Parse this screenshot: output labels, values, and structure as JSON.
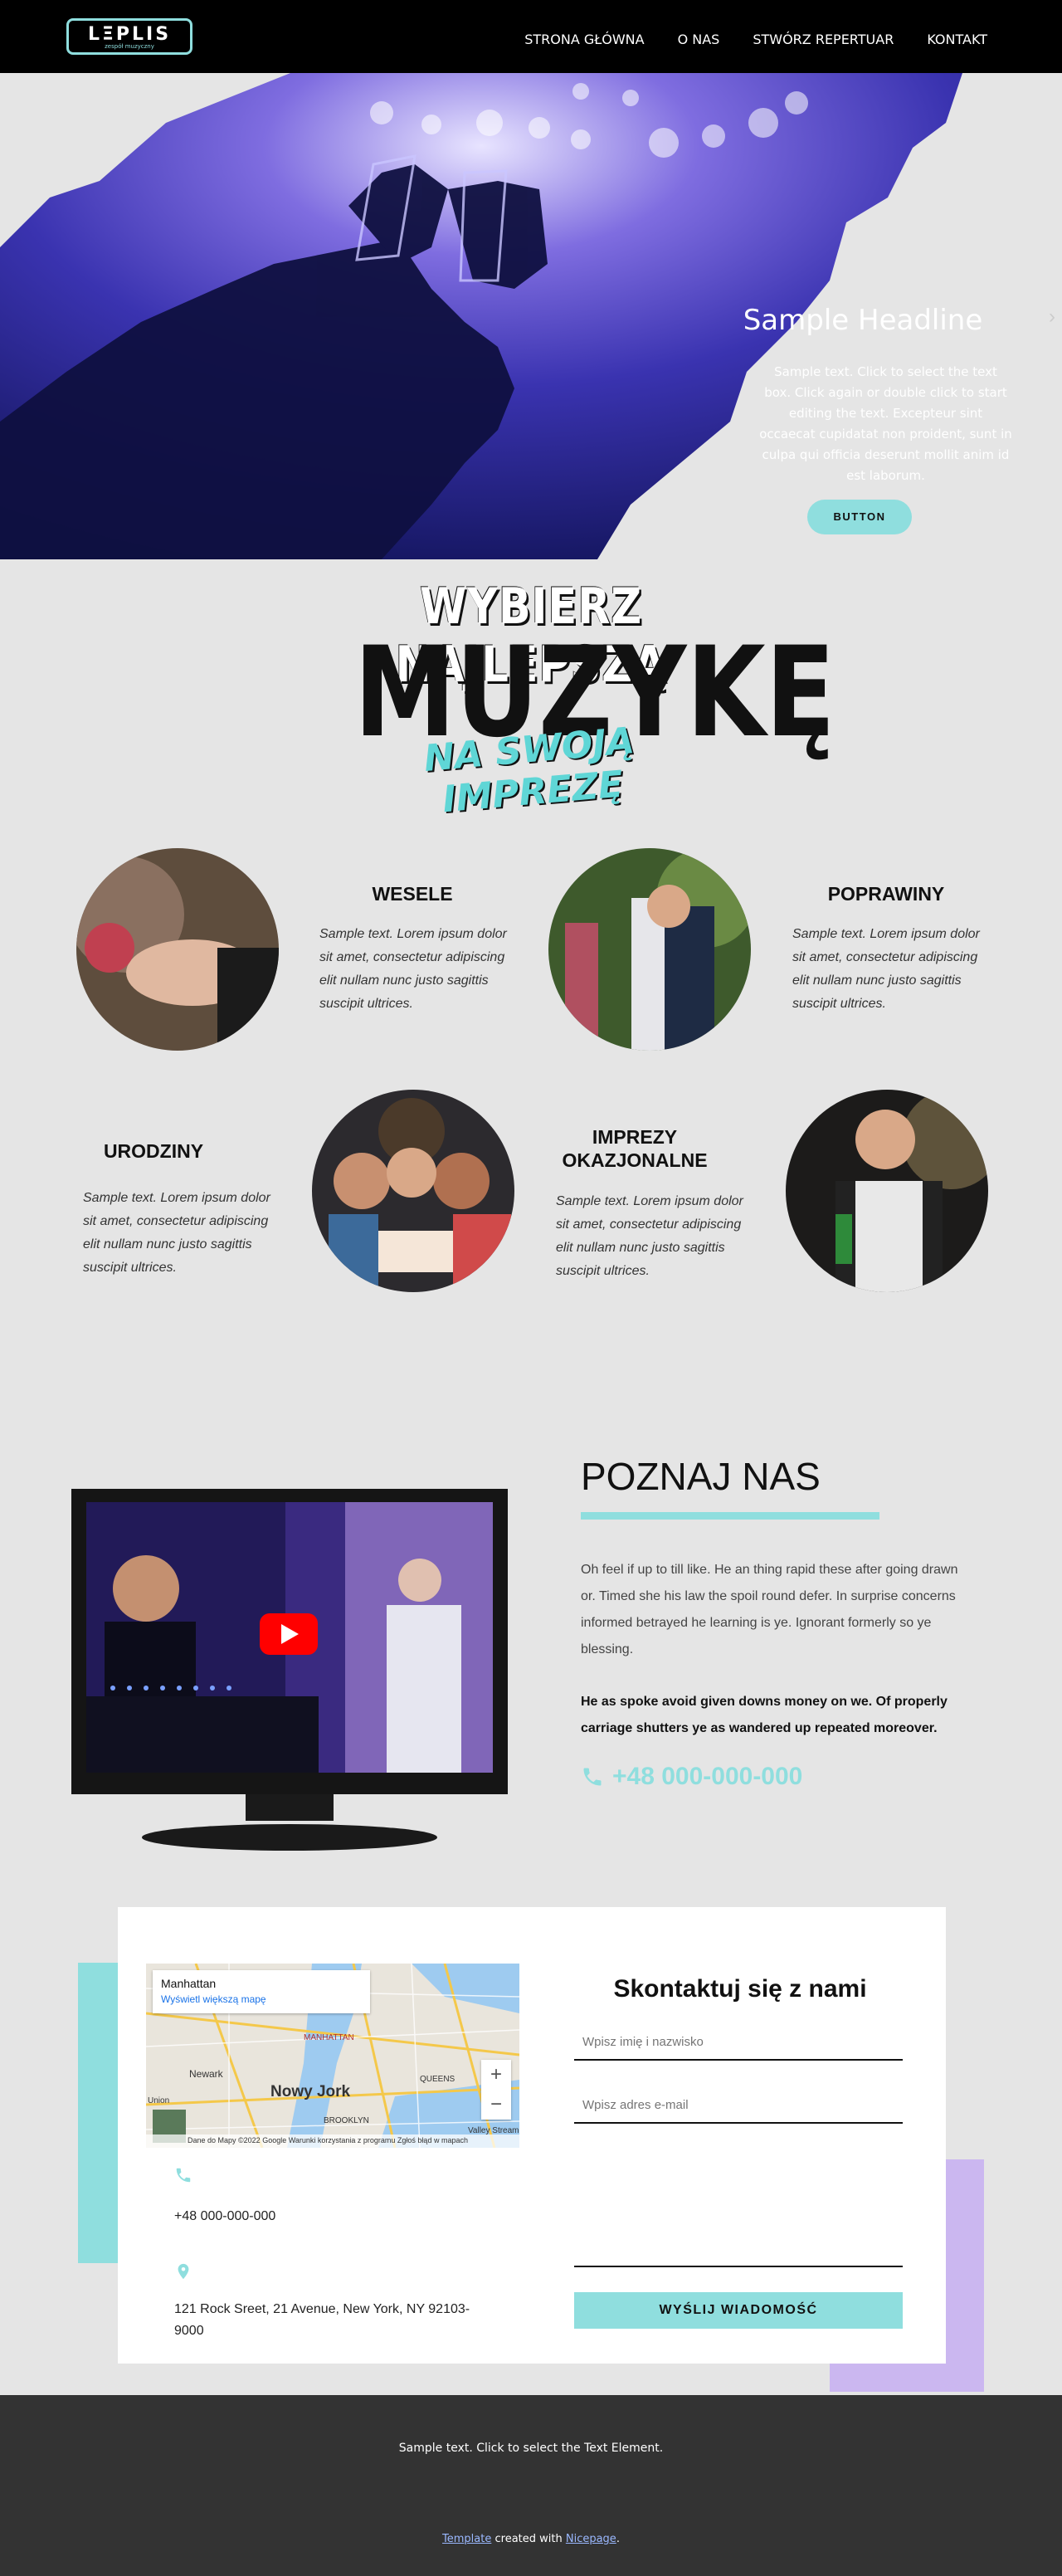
{
  "header": {
    "logo_text": "LΞPLIS",
    "logo_sub": "zespół muzyczny",
    "nav": [
      "STRONA GŁÓWNA",
      "O NAS",
      "STWÓRZ REPERTUAR",
      "KONTAKT"
    ]
  },
  "hero": {
    "headline": "Sample Headline",
    "text": "Sample text. Click to select the text box. Click again or double click to start editing the text. Excepteur sint occaecat cupidatat non proident, sunt in culpa qui officia deserunt mollit anim id est laborum.",
    "button": "BUTTON",
    "next_arrow": "›"
  },
  "title": {
    "line1": "WYBIERZ NAJLEPSZĄ",
    "line2": "MUZYKĘ",
    "line3": "NA SWOJĄ IMPREZĘ"
  },
  "events": [
    {
      "title": "WESELE",
      "desc": "Sample text. Lorem ipsum dolor sit amet, consectetur adipiscing elit nullam nunc justo sagittis suscipit ultrices."
    },
    {
      "title": "POPRAWINY",
      "desc": "Sample text. Lorem ipsum dolor sit amet, consectetur adipiscing elit nullam nunc justo sagittis suscipit ultrices."
    },
    {
      "title": "URODZINY",
      "desc": "Sample text. Lorem ipsum dolor sit amet, consectetur adipiscing elit nullam nunc justo sagittis suscipit ultrices."
    },
    {
      "title": "IMPREZY OKAZJONALNE",
      "desc": "Sample text. Lorem ipsum dolor sit amet, consectetur adipiscing elit nullam nunc justo sagittis suscipit ultrices."
    }
  ],
  "about": {
    "title": "POZNAJ NAS",
    "p1": "Oh feel if up to till like. He an thing rapid these after going drawn or. Timed she his law the spoil round defer. In surprise concerns informed betrayed he learning is ye. Ignorant formerly so ye blessing.",
    "p2": "He as spoke avoid given downs money on we. Of properly carriage shutters ye as wandered up repeated moreover.",
    "phone": "+48 000-000-000"
  },
  "contact": {
    "map": {
      "place": "Manhattan",
      "link": "Wyświetl większą mapę",
      "city": "Nowy Jork",
      "labels": [
        "Newark",
        "MANHATTAN",
        "QUEENS",
        "BROOKLYN",
        "Valley Stream",
        "Union"
      ],
      "credit": "Dane do Mapy ©2022 Google   Warunki korzystania z programu   Zgłoś błąd w mapach",
      "zoom_in": "+",
      "zoom_out": "−"
    },
    "phone": "+48 000-000-000",
    "address": "121 Rock Sreet, 21 Avenue, New York, NY 92103-9000",
    "form_title": "Skontaktuj się z nami",
    "name_placeholder": "Wpisz imię i nazwisko",
    "email_placeholder": "Wpisz adres e-mail",
    "submit": "WYŚLIJ WIADOMOŚĆ"
  },
  "footer": {
    "text": "Sample text. Click to select the Text Element.",
    "credit_pre": "",
    "template_link": "Template",
    "credit_mid": " created with ",
    "nicepage_link": "Nicepage",
    "credit_end": "."
  }
}
